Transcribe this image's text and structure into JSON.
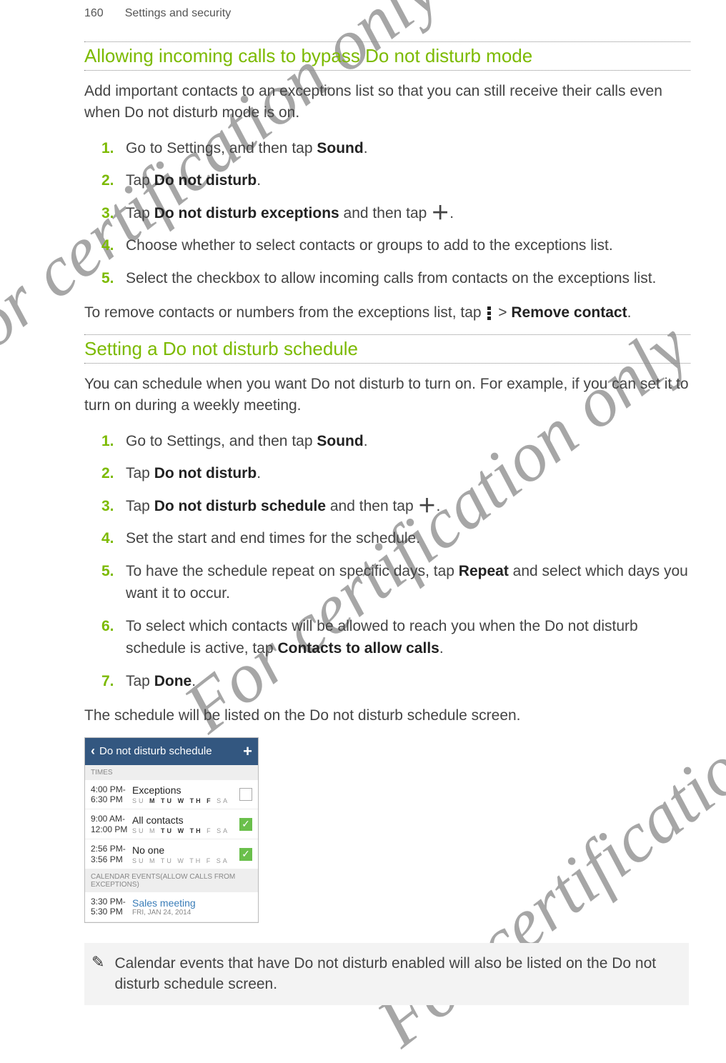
{
  "header": {
    "page_number": "160",
    "breadcrumb": "Settings and security"
  },
  "watermark_text": "For certification only",
  "section1": {
    "title": "Allowing incoming calls to bypass Do not disturb mode",
    "intro": "Add important contacts to an exceptions list so that you can still receive their calls even when Do not disturb mode is on.",
    "steps": {
      "s1_a": "Go to Settings, and then tap ",
      "s1_b": "Sound",
      "s1_c": ".",
      "s2_a": "Tap ",
      "s2_b": "Do not disturb",
      "s2_c": ".",
      "s3_a": "Tap ",
      "s3_b": "Do not disturb exceptions",
      "s3_c": " and then tap ",
      "s4": "Choose whether to select contacts or groups to add to the exceptions list.",
      "s5": "Select the checkbox to allow incoming calls from contacts on the exceptions list."
    },
    "outro_a": "To remove contacts or numbers from the exceptions list, tap ",
    "outro_b": " > ",
    "outro_c": "Remove contact",
    "outro_d": "."
  },
  "section2": {
    "title": "Setting a Do not disturb schedule",
    "intro": "You can schedule when you want Do not disturb to turn on. For example, if you can set it to turn on during a weekly meeting.",
    "steps": {
      "s1_a": "Go to Settings, and then tap ",
      "s1_b": "Sound",
      "s1_c": ".",
      "s2_a": "Tap ",
      "s2_b": "Do not disturb",
      "s2_c": ".",
      "s3_a": "Tap ",
      "s3_b": "Do not disturb schedule",
      "s3_c": " and then tap ",
      "s4": "Set the start and end times for the schedule.",
      "s5_a": "To have the schedule repeat on specific days, tap ",
      "s5_b": "Repeat",
      "s5_c": " and select which days you want it to occur.",
      "s6_a": "To select which contacts will be allowed to reach you when the Do not disturb schedule is active, tap ",
      "s6_b": "Contacts to allow calls",
      "s6_c": ".",
      "s7_a": "Tap ",
      "s7_b": "Done",
      "s7_c": "."
    },
    "outro": "The schedule will be listed on the Do not disturb schedule screen."
  },
  "phone": {
    "title": "Do not disturb schedule",
    "plus": "+",
    "label_times": "TIMES",
    "rows": [
      {
        "time_a": "4:00 PM-",
        "time_b": "6:30 PM",
        "name": "Exceptions",
        "checked": false,
        "days_on": [
          1,
          2,
          3,
          4,
          5
        ]
      },
      {
        "time_a": "9:00 AM-",
        "time_b": "12:00 PM",
        "name": "All contacts",
        "checked": true,
        "days_on": [
          2,
          3,
          4
        ]
      },
      {
        "time_a": "2:56 PM-",
        "time_b": "3:56 PM",
        "name": "No one",
        "checked": true,
        "days_on": []
      }
    ],
    "label_cal": "CALENDAR EVENTS(ALLOW CALLS FROM EXCEPTIONS)",
    "cal_time_a": "3:30 PM-",
    "cal_time_b": "5:30 PM",
    "cal_name": "Sales meeting",
    "cal_sub": "FRI, JAN 24, 2014"
  },
  "note": "Calendar events that have Do not disturb enabled will also be listed on the Do not disturb schedule screen."
}
